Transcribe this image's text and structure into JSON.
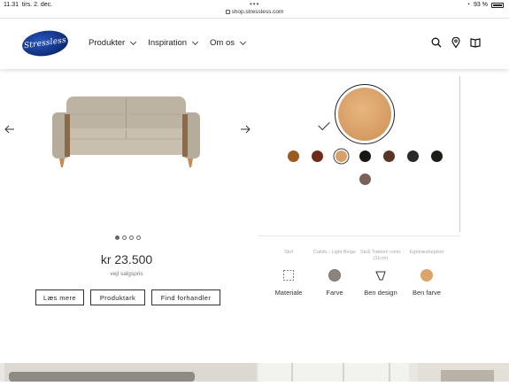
{
  "status_bar": {
    "time": "11.31",
    "date": "tirs. 2. dec.",
    "url": "shop.stressless.com",
    "battery": "93 %"
  },
  "header": {
    "logo_text": "Stressless",
    "nav": [
      {
        "label": "Produkter"
      },
      {
        "label": "Inspiration"
      },
      {
        "label": "Om os"
      }
    ],
    "icons": [
      "search-icon",
      "location-icon",
      "catalog-icon"
    ]
  },
  "product": {
    "price": "kr 23.500",
    "price_note": "vejl salgspris",
    "carousel": {
      "total": 4,
      "active": 1
    },
    "buttons": {
      "read_more": "Læs mere",
      "product_sheet": "Produktark",
      "find_dealer": "Find forhandler"
    }
  },
  "configurator": {
    "selected_color": "#d99d61",
    "swatches": [
      {
        "name": "swatch-1",
        "color": "#9b5a1e"
      },
      {
        "name": "swatch-2",
        "color": "#6e2b1a"
      },
      {
        "name": "swatch-3",
        "color": "#d9a068",
        "selected": true
      },
      {
        "name": "swatch-4",
        "color": "#1b1712"
      },
      {
        "name": "swatch-5",
        "color": "#5a3424"
      },
      {
        "name": "swatch-6",
        "color": "#2a2a28"
      },
      {
        "name": "swatch-7",
        "color": "#1a1f18"
      },
      {
        "name": "swatch-8",
        "color": "#7a6258"
      }
    ],
    "options": [
      {
        "sub": "Stof",
        "label": "Materiale"
      },
      {
        "sub": "Calido - Light Beige",
        "label": "Farve"
      },
      {
        "sub": "Skrå Træben conic (11cm)",
        "label": "Ben design"
      },
      {
        "sub": "Egetræsbejdset",
        "label": "Ben farve"
      }
    ]
  }
}
